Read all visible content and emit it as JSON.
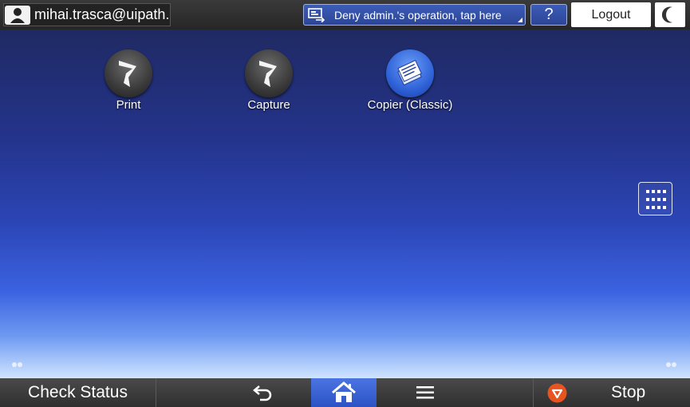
{
  "header": {
    "user_name": "mihai.trasca@uipath.",
    "deny_label": "Deny admin.'s operation, tap here",
    "help_label": "?",
    "logout_label": "Logout"
  },
  "apps": [
    {
      "label": "Print",
      "icon": "print-app-icon"
    },
    {
      "label": "Capture",
      "icon": "capture-app-icon"
    },
    {
      "label": "Copier (Classic)",
      "icon": "copier-app-icon"
    }
  ],
  "footer": {
    "check_status_label": "Check Status",
    "stop_label": "Stop"
  },
  "colors": {
    "accent": "#2c52c3",
    "background_top": "#1f2a63",
    "background_bottom": "#cfe4ff",
    "stop": "#e8531f"
  }
}
